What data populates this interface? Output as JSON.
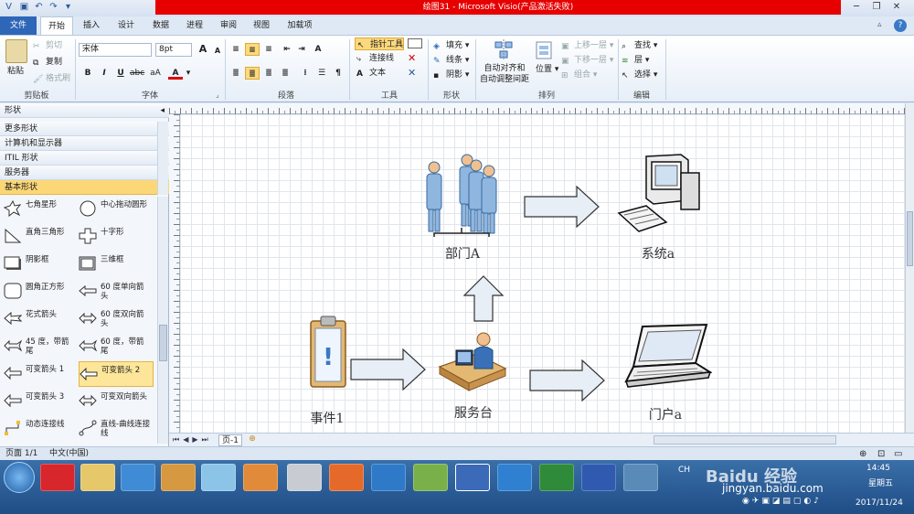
{
  "window": {
    "title": "绘图31 - Microsoft Visio(产品激活失败)"
  },
  "tabs": [
    "文件",
    "开始",
    "插入",
    "设计",
    "数据",
    "进程",
    "审阅",
    "视图",
    "加载项"
  ],
  "ribbon": {
    "clipboard": {
      "paste": "粘贴",
      "cut": "剪切",
      "copy": "复制",
      "format_painter": "格式刷",
      "label": "剪贴板"
    },
    "font": {
      "family": "宋体",
      "size": "8pt",
      "label": "字体"
    },
    "paragraph": {
      "label": "段落"
    },
    "tools": {
      "pointer": "指针工具",
      "connector": "连接线",
      "text": "文本",
      "label": "工具"
    },
    "shape": {
      "fill": "填充",
      "line": "线条",
      "shadow": "阴影",
      "label": "形状"
    },
    "arrange": {
      "auto_align": "自动对齐和\n自动调整间距",
      "position": "位置",
      "bring_forward": "上移一层",
      "send_backward": "下移一层",
      "group": "组合",
      "label": "排列"
    },
    "editing": {
      "find": "查找",
      "layer": "层",
      "select": "选择",
      "label": "编辑"
    }
  },
  "shapes_panel": {
    "title": "形状",
    "categories": [
      "更多形状",
      "计算机和显示器",
      "ITIL 形状",
      "服务器",
      "基本形状"
    ],
    "selected_category": "基本形状",
    "items": [
      {
        "label": "七角星形",
        "icon": "seven-point-star-icon"
      },
      {
        "label": "中心拖动圆形",
        "icon": "circle-icon"
      },
      {
        "label": "直角三角形",
        "icon": "right-triangle-icon"
      },
      {
        "label": "十字形",
        "icon": "cross-icon"
      },
      {
        "label": "阴影框",
        "icon": "shadow-box-icon"
      },
      {
        "label": "三维框",
        "icon": "3d-box-icon"
      },
      {
        "label": "圆角正方形",
        "icon": "rounded-square-icon"
      },
      {
        "label": "60 度单向箭头",
        "icon": "single-arrow-icon"
      },
      {
        "label": "花式箭头",
        "icon": "fancy-arrow-icon"
      },
      {
        "label": "60 度双向箭头",
        "icon": "double-arrow-icon"
      },
      {
        "label": "45 度，带箭尾",
        "icon": "tail-arrow-icon"
      },
      {
        "label": "60 度，带箭尾",
        "icon": "tail-arrow-icon"
      },
      {
        "label": "可变箭头 1",
        "icon": "variable-arrow-icon"
      },
      {
        "label": "可变箭头 2",
        "icon": "variable-arrow-icon"
      },
      {
        "label": "可变箭头 3",
        "icon": "variable-arrow-icon"
      },
      {
        "label": "可变双向箭头",
        "icon": "variable-double-arrow-icon"
      },
      {
        "label": "动态连接线",
        "icon": "dynamic-connector-icon"
      },
      {
        "label": "直线-曲线连接线",
        "icon": "curve-connector-icon"
      }
    ],
    "highlighted_item": "可变箭头 2"
  },
  "diagram": {
    "labels": {
      "dept": "部门A",
      "system": "系统a",
      "event": "事件1",
      "service": "服务台",
      "portal": "门户a"
    }
  },
  "pagebar": {
    "page_tab": "页-1"
  },
  "status": {
    "page": "页面 1/1",
    "language": "中文(中国)"
  },
  "tray": {
    "time": "14:45",
    "weekday": "星期五",
    "date": "2017/11/24",
    "ime": "CH"
  },
  "watermark": "jingyan.baidu.com"
}
